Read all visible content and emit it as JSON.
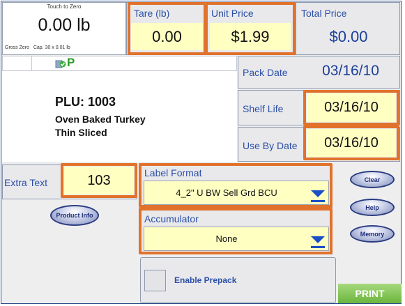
{
  "scale": {
    "touch_to_zero": "Touch to Zero",
    "weight": "0.00 lb",
    "footer": "Gross Zero   Cap. 30 x 0.01 lb"
  },
  "tare": {
    "label": "Tare (lb)",
    "value": "0.00"
  },
  "unit_price": {
    "label": "Unit Price",
    "value": "$1.99"
  },
  "total_price": {
    "label": "Total Price",
    "value": "$0.00"
  },
  "product": {
    "plu": "PLU: 1003",
    "line1": "Oven Baked Turkey",
    "line2": "Thin Sliced",
    "status_icons": [
      "checkmark-icon",
      "p-icon"
    ]
  },
  "dates": {
    "pack_date": {
      "label": "Pack Date",
      "value": "03/16/10"
    },
    "shelf_life": {
      "label": "Shelf Life",
      "value": "03/16/10"
    },
    "use_by": {
      "label": "Use By Date",
      "value": "03/16/10"
    }
  },
  "extra_text": {
    "label": "Extra Text",
    "value": "103"
  },
  "product_info_button": "Product Info",
  "label_format": {
    "label": "Label Format",
    "value": "4_2\" U BW Sell Grd BCU"
  },
  "accumulator": {
    "label": "Accumulator",
    "value": "None"
  },
  "enable_prepack": {
    "label": "Enable Prepack",
    "checked": false
  },
  "buttons": {
    "clear": "Clear",
    "help": "Help",
    "memory": "Memory",
    "print": "PRINT"
  },
  "colors": {
    "highlight": "#e1722c",
    "label_blue": "#2b4fa6",
    "value_blue": "#1c3f9a",
    "field_yellow": "#ffffc2",
    "print_green": "#7cc34a"
  }
}
